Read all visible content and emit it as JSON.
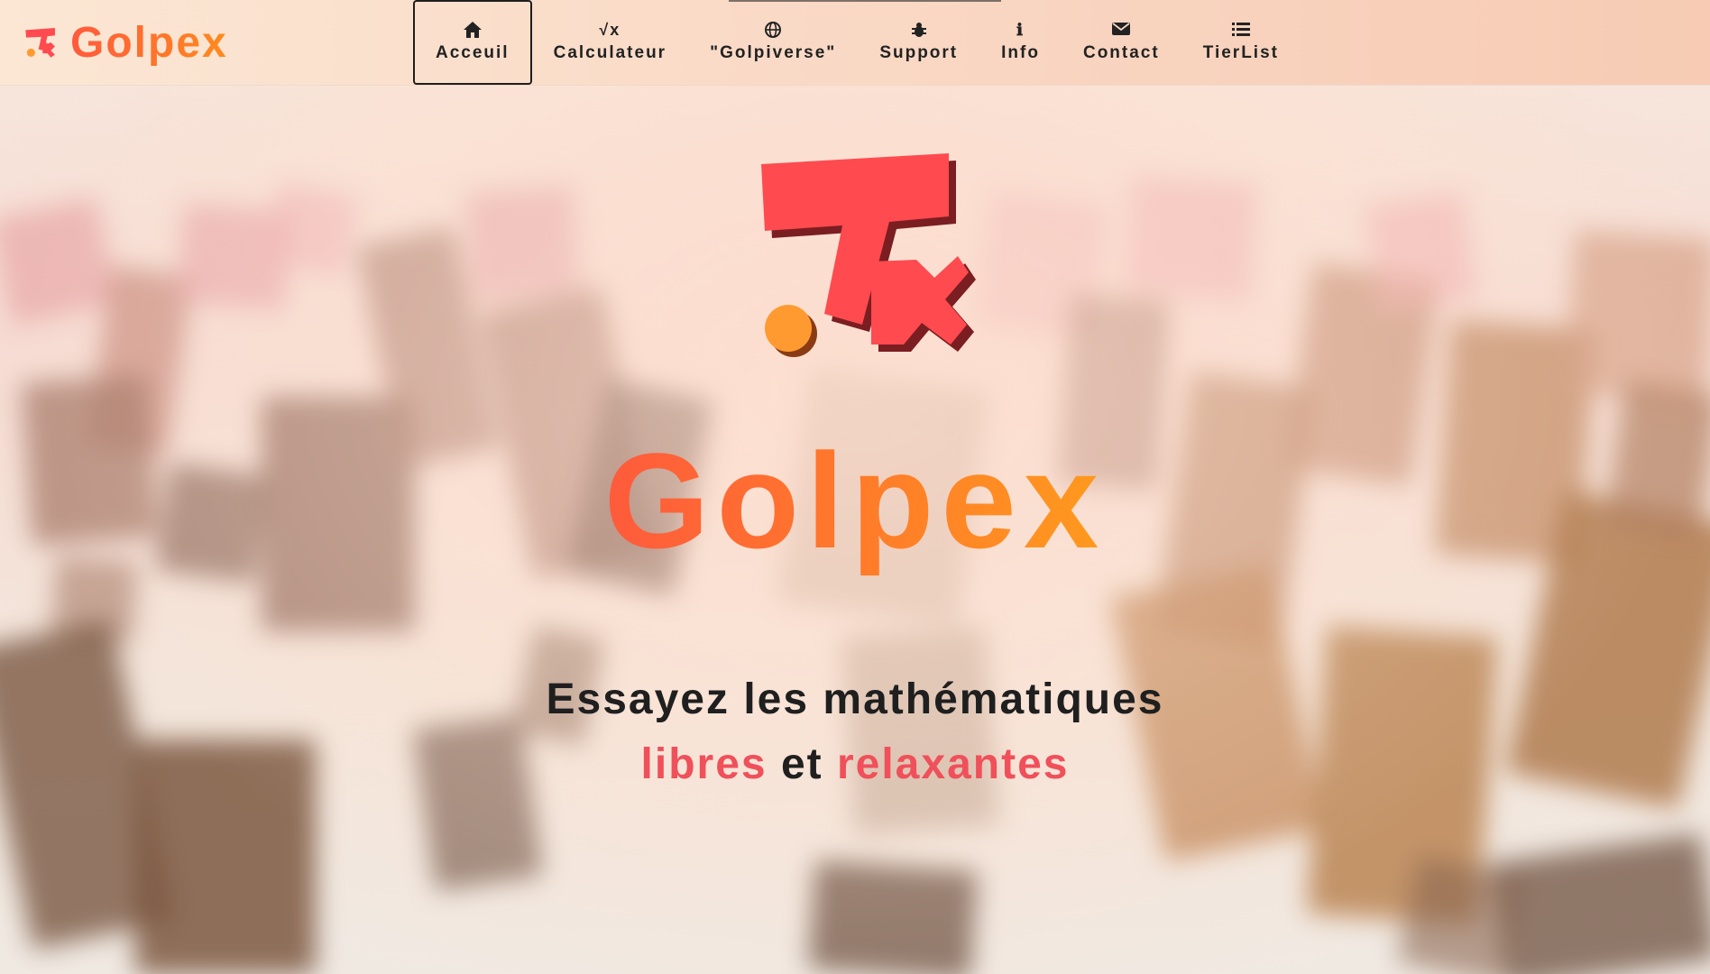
{
  "brand": {
    "name": "Golpex"
  },
  "nav": {
    "items": [
      {
        "label": "Acceuil",
        "icon": "home-icon",
        "active": true
      },
      {
        "label": "Calculateur",
        "icon": "square-root-icon"
      },
      {
        "label": "\"Golpiverse\"",
        "icon": "globe-icon"
      },
      {
        "label": "Support",
        "icon": "bug-icon"
      },
      {
        "label": "Info",
        "icon": "info-icon"
      },
      {
        "label": "Contact",
        "icon": "envelope-icon"
      },
      {
        "label": "TierList",
        "icon": "list-icon"
      }
    ]
  },
  "hero": {
    "title": "Golpex",
    "tagline_line1": "Essayez les mathématiques",
    "tagline_word1": "libres",
    "tagline_mid": "et",
    "tagline_word2": "relaxantes"
  },
  "colors": {
    "accent_red": "#f0505a",
    "brand_orange": "#ff8a1e",
    "logo_red": "#ff4a4f",
    "logo_dot": "#ff9a30"
  }
}
